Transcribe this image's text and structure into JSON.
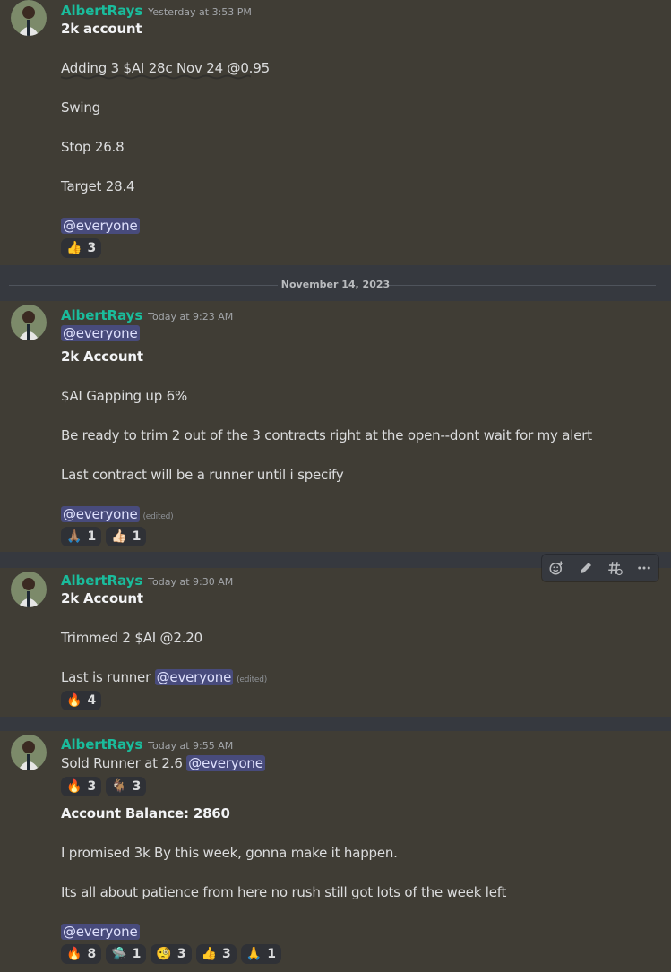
{
  "messages": [
    {
      "author": "AlbertRays",
      "timestamp": "Yesterday at 3:53 PM",
      "lines": [
        "2k account",
        "Adding 3 $AI 28c Nov 24 @0.95",
        "Swing",
        "Stop 26.8",
        "Target 28.4"
      ],
      "mention": "@everyone",
      "reactions": [
        {
          "emoji": "👍",
          "icon": "thumbs-up",
          "count": "3"
        }
      ]
    },
    {
      "author": "AlbertRays",
      "timestamp": "Today at 9:23 AM",
      "mention_top": "@everyone",
      "lines": [
        "2k Account",
        "$AI Gapping up 6%",
        "Be ready to trim 2 out of the 3 contracts right at the open--dont wait for my alert",
        "Last contract will be a runner until i specify"
      ],
      "mention": "@everyone",
      "edited": "(edited)",
      "reactions": [
        {
          "emoji": "🙏🏽",
          "icon": "folded-hands",
          "count": "1"
        },
        {
          "emoji": "👍🏻",
          "icon": "thumbs-up-light",
          "count": "1"
        }
      ]
    },
    {
      "author": "AlbertRays",
      "timestamp": "Today at 9:30 AM",
      "lines": [
        "2k Account",
        "Trimmed 2 $AI @2.20",
        "Last is runner"
      ],
      "mention": "@everyone",
      "edited": "(edited)",
      "reactions": [
        {
          "emoji": "🔥",
          "icon": "fire",
          "count": "4"
        }
      ]
    },
    {
      "author": "AlbertRays",
      "timestamp": "Today at 9:55 AM",
      "lines": [
        "Sold Runner at 2.6",
        "Account Balance: 2860",
        "I promised 3k By this week, gonna make it happen.",
        "Its all about patience from here no rush still got lots of the week left"
      ],
      "mention_inline": "@everyone",
      "mention": "@everyone",
      "reactions_top": [
        {
          "emoji": "🔥",
          "icon": "fire",
          "count": "3"
        },
        {
          "emoji": "🐐",
          "icon": "goat",
          "count": "3"
        }
      ],
      "reactions": [
        {
          "emoji": "🔥",
          "icon": "fire",
          "count": "8"
        },
        {
          "emoji": "🛸",
          "icon": "custom-emoji",
          "count": "1"
        },
        {
          "emoji": "🧐",
          "icon": "face-monocle",
          "count": "3"
        },
        {
          "emoji": "👍",
          "icon": "thumbs-up",
          "count": "3"
        },
        {
          "emoji": "🙏",
          "icon": "folded-hands",
          "count": "1"
        }
      ]
    }
  ],
  "date_divider": "November 14, 2023",
  "toolbar": {
    "icons": [
      "add-reaction-icon",
      "edit-icon",
      "create-thread-icon",
      "more-icon"
    ]
  },
  "colors": {
    "author": "#1abc9c",
    "background": "#403d35",
    "mention_bg": "#5865f2"
  }
}
